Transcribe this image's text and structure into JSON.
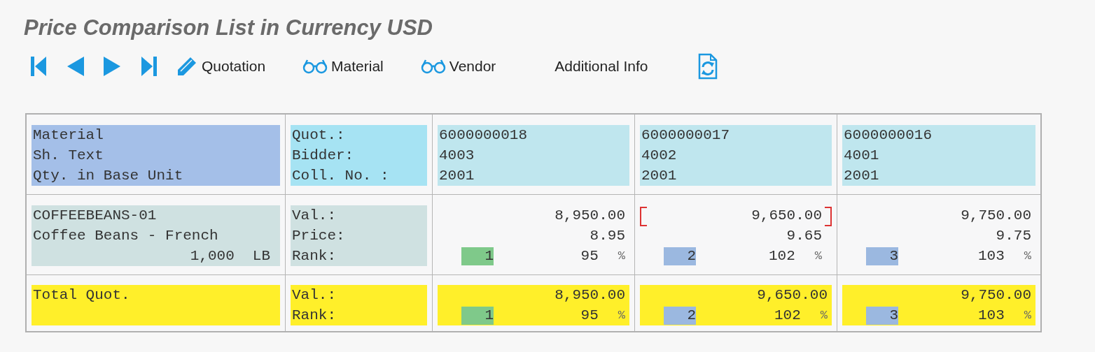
{
  "title": "Price Comparison List in Currency USD",
  "toolbar": [
    {
      "kind": "first"
    },
    {
      "kind": "previous"
    },
    {
      "kind": "next"
    },
    {
      "kind": "last"
    },
    {
      "kind": "edit",
      "label": "Quotation"
    },
    {
      "kind": "view",
      "label": "Material"
    },
    {
      "kind": "view",
      "label": "Vendor"
    },
    {
      "kind": "text",
      "label": "Additional Info"
    },
    {
      "kind": "refresh"
    }
  ],
  "header": {
    "labels": [
      "Material",
      "Sh. Text",
      "Qty. in Base Unit"
    ],
    "field_labels": [
      "Quot.:",
      "Bidder:",
      "Coll. No. :"
    ]
  },
  "item": {
    "material": "COFFEEBEANS-01",
    "short_text": "Coffee Beans - French",
    "quantity": "1,000",
    "unit": "LB",
    "field_labels": [
      "Val.:",
      "Price:",
      "Rank:"
    ]
  },
  "total": {
    "label": "Total Quot.",
    "field_labels": [
      "Val.:",
      "Rank:"
    ]
  },
  "quotations": [
    {
      "number": "6000000018",
      "bidder": "4003",
      "collective_no": "2001",
      "value": "8,950.00",
      "price": "8.95",
      "rank": "1",
      "color": "#7fc98a",
      "percent": "95",
      "percent_sign": "%",
      "selected": false,
      "total_value": "8,950.00",
      "total_rank": "1",
      "total_percent": "95",
      "total_percent_sign": "%"
    },
    {
      "number": "6000000017",
      "bidder": "4002",
      "collective_no": "2001",
      "value": "9,650.00",
      "price": "9.65",
      "rank": "2",
      "color": "#9bb8e0",
      "percent": "102",
      "percent_sign": "%",
      "selected": true,
      "total_value": "9,650.00",
      "total_rank": "2",
      "total_percent": "102",
      "total_percent_sign": "%"
    },
    {
      "number": "6000000016",
      "bidder": "4001",
      "collective_no": "2001",
      "value": "9,750.00",
      "price": "9.75",
      "rank": "3",
      "color": "#9bb8e0",
      "percent": "103",
      "percent_sign": "%",
      "selected": false,
      "total_value": "9,750.00",
      "total_rank": "3",
      "total_percent": "103",
      "total_percent_sign": "%"
    }
  ]
}
